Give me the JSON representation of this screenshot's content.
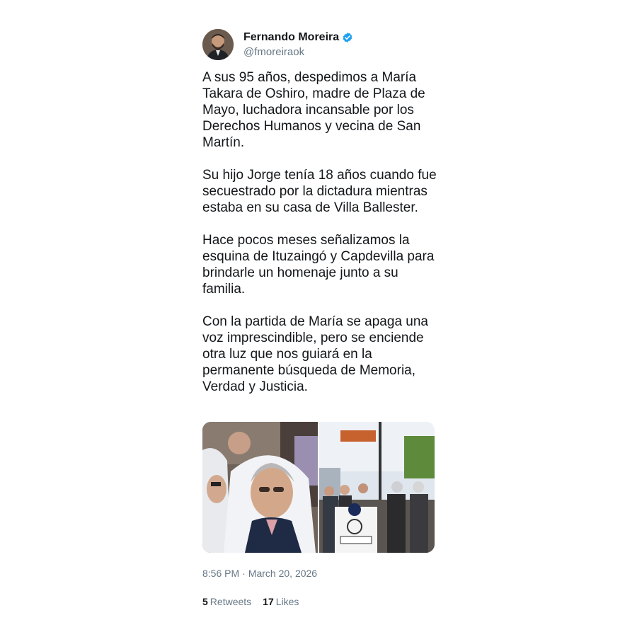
{
  "author": {
    "name": "Fernando Moreira",
    "handle": "@fmoreiraok",
    "verified": true,
    "verified_color": "#1da1f2"
  },
  "tweet": {
    "paragraphs": [
      "A sus 95 años, despedimos a María Takara de Oshiro, madre de Plaza de Mayo, luchadora incansable por los Derechos Humanos y vecina de San Martín.",
      "Su hijo Jorge tenía 18 años cuando fue secuestrado por la dictadura mientras estaba en su casa de Villa Ballester.",
      "Hace pocos meses señalizamos la esquina de Ituzaingó y Capdevilla para brindarle un homenaje junto a su familia.",
      "Con la partida de María se apaga una voz imprescindible, pero se enciende otra luz que nos guiará en la permanente búsqueda de Memoria, Verdad y Justicia."
    ],
    "time": "8:56 PM",
    "separator": "·",
    "date": "March 20, 2026"
  },
  "stats": {
    "retweets_count": "5",
    "retweets_label": "Retweets",
    "likes_count": "17",
    "likes_label": "Likes"
  },
  "media": {
    "photo_left": "photo-women-white-headscarves",
    "photo_right": "photo-street-sign-homage"
  }
}
